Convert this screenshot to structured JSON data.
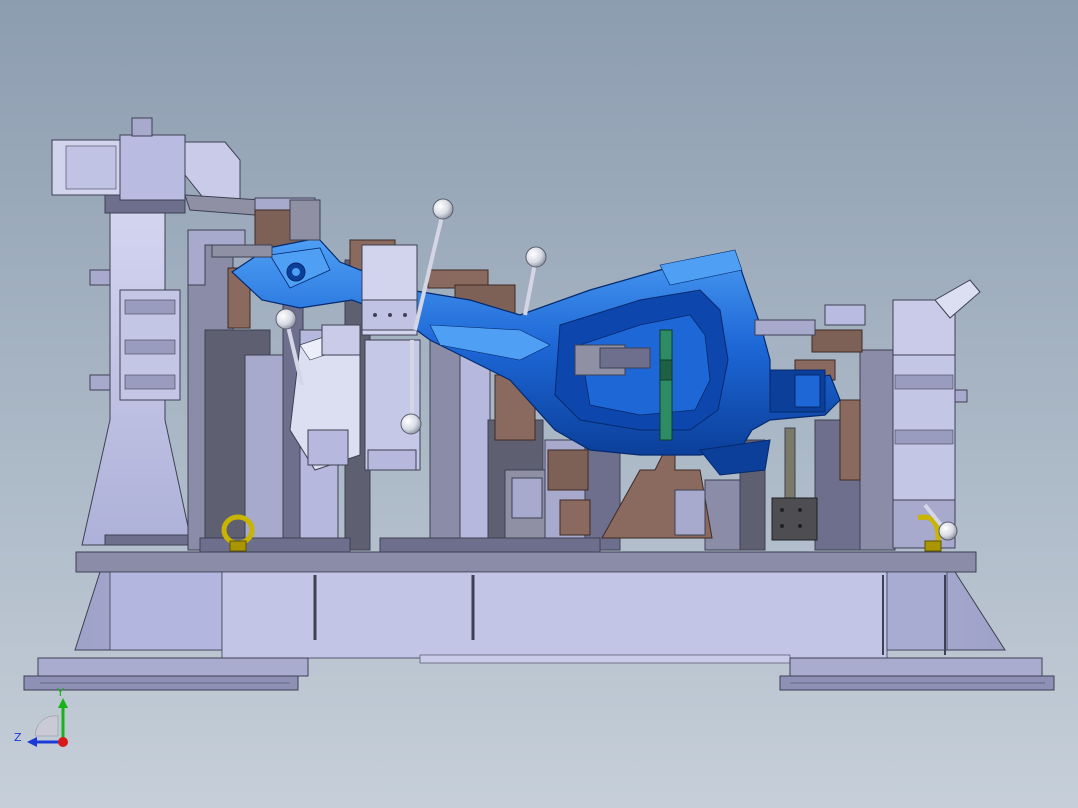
{
  "viewport": {
    "background_top": "#8d9db0",
    "background_bottom": "#c6cfd9"
  },
  "colors": {
    "frame": "#b9bce0",
    "frame_dark": "#6d6f8c",
    "base": "#c0c2e4",
    "steel_dark": "#5e5f70",
    "steel_mid": "#8f90a4",
    "part_blue": "#1d67d6",
    "part_blue_dark": "#0b3f9a",
    "part_blue_light": "#4fa0f5",
    "bracket_brown": "#8a6a5e",
    "bracket_brown_dark": "#5a4038",
    "eye_bolt": "#c9b400",
    "handle_ball": "#e6e8ef",
    "accent_green": "#2e8c64"
  },
  "triad": {
    "y_label": "Y",
    "z_label": "Z",
    "y_color": "#1ab21a",
    "z_color": "#1a3ad6",
    "x_color": "#d61a1a"
  }
}
